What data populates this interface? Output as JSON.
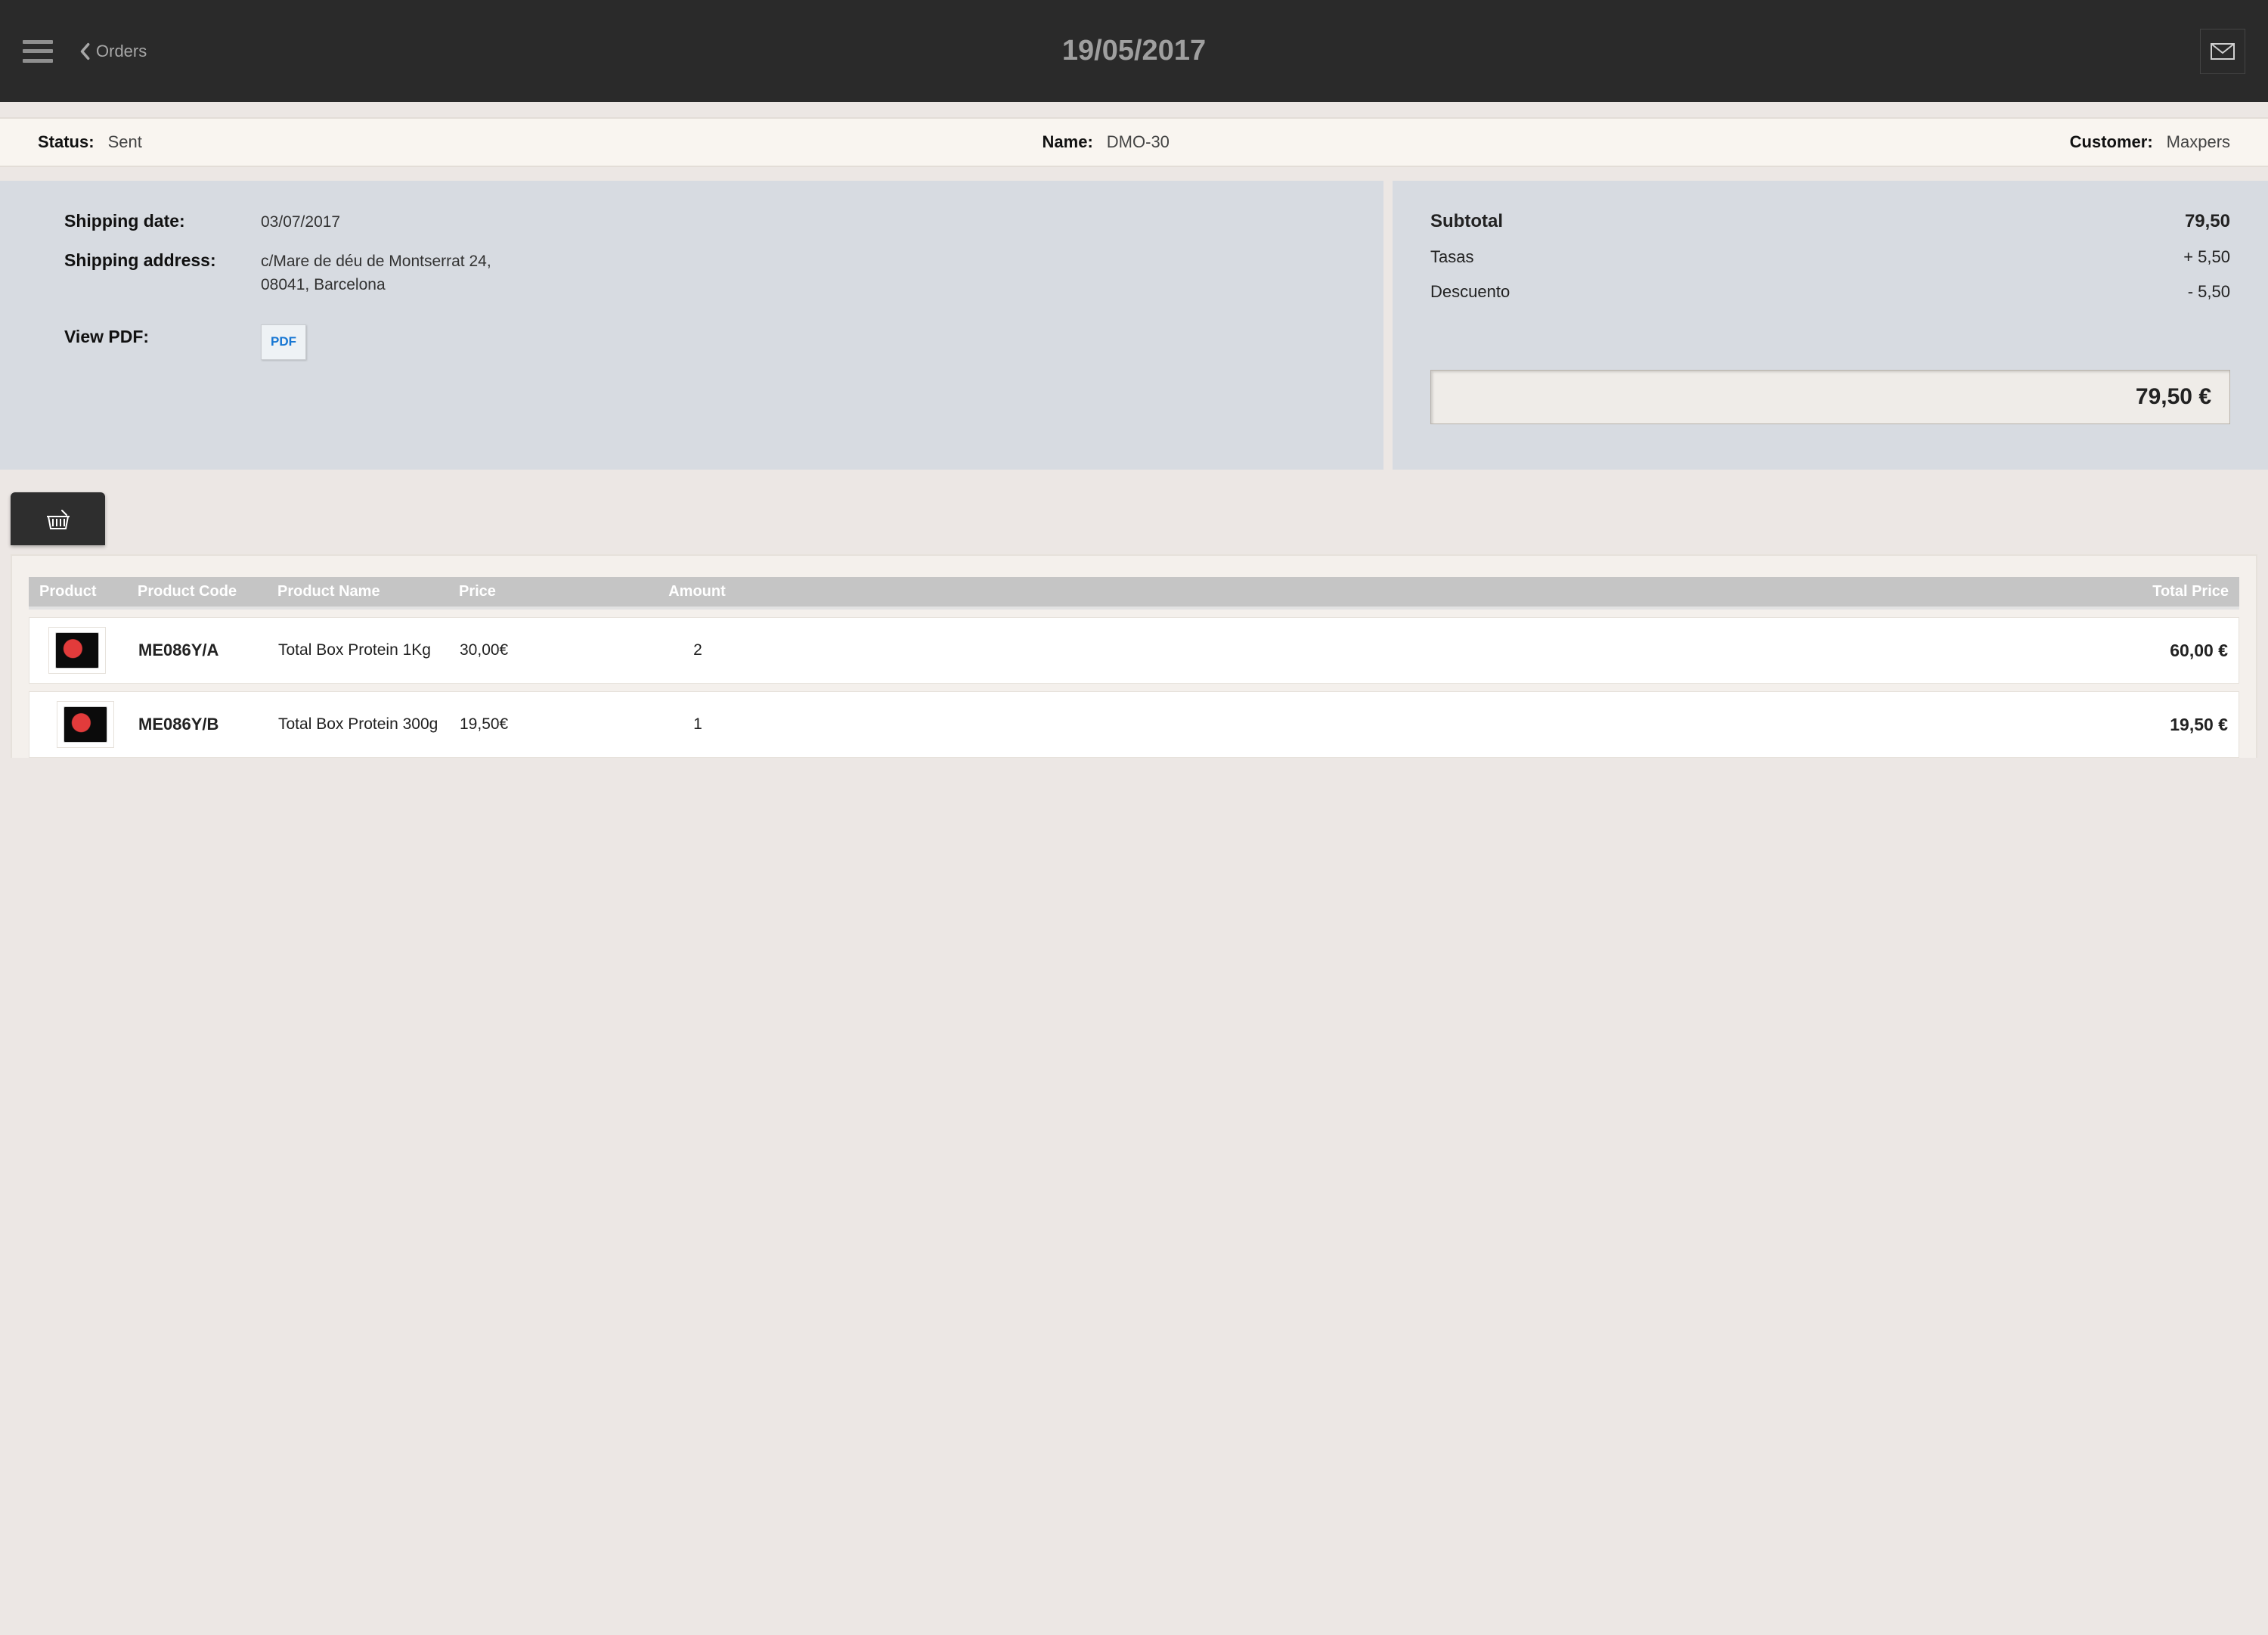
{
  "header": {
    "back_label": "Orders",
    "title": "19/05/2017"
  },
  "info": {
    "status_label": "Status:",
    "status_value": "Sent",
    "name_label": "Name:",
    "name_value": "DMO-30",
    "customer_label": "Customer:",
    "customer_value": "Maxpers"
  },
  "shipping": {
    "date_label": "Shipping date:",
    "date_value": "03/07/2017",
    "addr_label": "Shipping address:",
    "addr_line1": "c/Mare de déu de Montserrat 24,",
    "addr_line2": "08041, Barcelona",
    "pdf_label": "View PDF:",
    "pdf_button": "PDF"
  },
  "totals": {
    "subtotal_label": "Subtotal",
    "subtotal_value": "79,50",
    "tax_label": "Tasas",
    "tax_value": "+ 5,50",
    "discount_label": "Descuento",
    "discount_value": "- 5,50",
    "grand_total": "79,50 €"
  },
  "table": {
    "headers": {
      "product": "Product",
      "code": "Product Code",
      "name": "Product Name",
      "price": "Price",
      "amount": "Amount",
      "total": "Total Price"
    },
    "rows": [
      {
        "code": "ME086Y/A",
        "name": "Total Box Protein 1Kg",
        "price": "30,00€",
        "amount": "2",
        "total": "60,00 €"
      },
      {
        "code": "ME086Y/B",
        "name": "Total Box Protein 300g",
        "price": "19,50€",
        "amount": "1",
        "total": "19,50 €"
      }
    ]
  }
}
